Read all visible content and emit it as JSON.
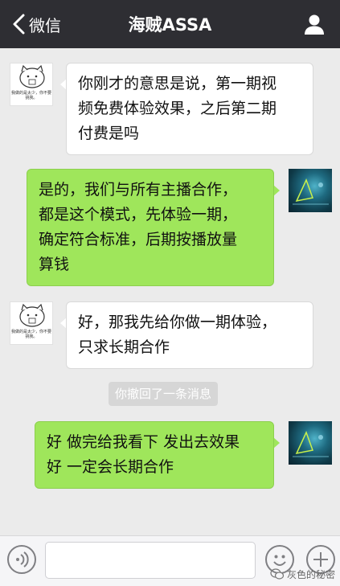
{
  "header": {
    "back_label": "微信",
    "title": "海贼ASSA",
    "back_icon": "chevron-left-icon",
    "profile_icon": "person-icon"
  },
  "messages": [
    {
      "side": "in",
      "avatar_caption": "我做的是太少，你不要挑我。",
      "text": "你刚才的意思是说，第一期视\n频免费体验效果，之后第二期\n付费是吗"
    },
    {
      "side": "out",
      "text": "是的，我们与所有主播合作，\n都是这个模式，先体验一期，\n确定符合标准，后期按播放量\n算钱"
    },
    {
      "side": "in",
      "avatar_caption": "我做的是太少，你不要挑我。",
      "text": "好，那我先给你做一期体验，\n只求长期合作"
    },
    {
      "side": "out",
      "text": "好 做完给我看下 发出去效果\n好  一定会长期合作"
    }
  ],
  "system_message": "你撤回了一条消息",
  "input_bar": {
    "voice_icon": "voice-icon",
    "emoji_icon": "emoji-icon",
    "plus_icon": "plus-icon",
    "text_value": "",
    "placeholder": ""
  },
  "watermark": "灰色的秘密",
  "colors": {
    "nav_bg": "#2e2e33",
    "chat_bg": "#ebebeb",
    "out_bubble": "#9fe65b",
    "in_bubble": "#ffffff"
  }
}
